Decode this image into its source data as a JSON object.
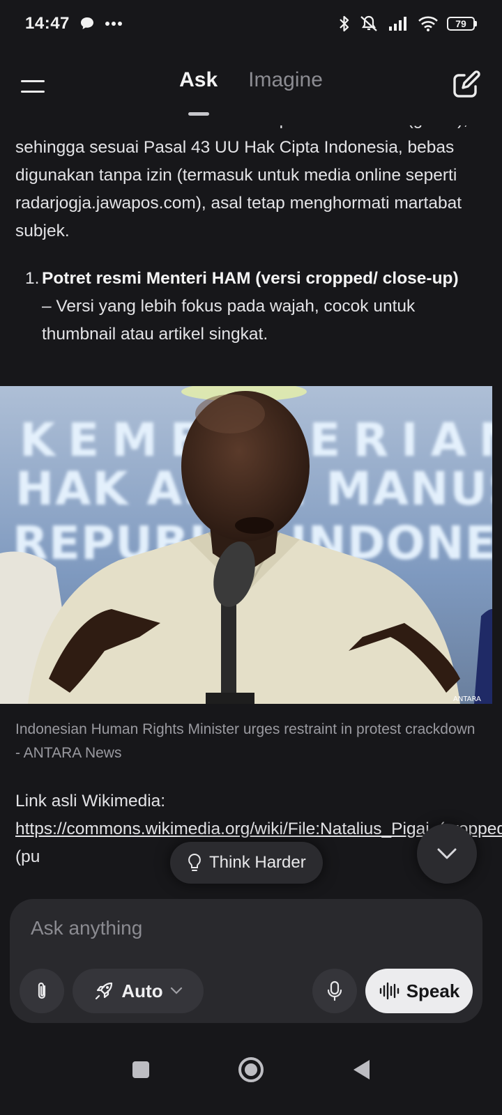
{
  "status_bar": {
    "time": "14:47",
    "left_icons": [
      "chat-bubble-icon",
      "more-dots-icon"
    ],
    "right_icons": [
      "bluetooth-icon",
      "mute-icon",
      "signal-icon",
      "wifi-icon"
    ],
    "battery": "79"
  },
  "header": {
    "tabs": [
      {
        "label": "Ask",
        "active": true
      },
      {
        "label": "Imagine",
        "active": false
      }
    ]
  },
  "content": {
    "cut_line": "Data dari situs web Pemerintah Republik Indonesia (gov.id),",
    "paragraph1": "sehingga sesuai Pasal 43 UU Hak Cipta Indonesia, bebas digunakan tanpa izin (termasuk untuk media online seperti radarjogja.jawapos.com), asal tetap menghormati martabat subjek.",
    "list_item": {
      "number": "1.",
      "bold": "Potret resmi Menteri HAM (versi cropped/ close-up)",
      "text": " – Versi yang lebih fokus pada wajah, cocok untuk thumbnail atau artikel singkat."
    },
    "image": {
      "banner_lines": [
        "KEMENTERIAN",
        "HAK ASASI MANUSIA",
        "REPUBLIK INDONESIA"
      ],
      "watermark": "ANTARA"
    },
    "caption": "Indonesian Human Rights Minister urges restraint in protest crackdown -  ANTARA News",
    "link_label": "Link asli Wikimedia:",
    "link_url": "https://commons.wikimedia.org/wiki/File:Natalius_Pigai_(cropped).png",
    "link_suffix": " (pu"
  },
  "think_button": {
    "label": "Think Harder"
  },
  "composer": {
    "placeholder": "Ask anything",
    "mode_label": "Auto",
    "speak_label": "Speak"
  },
  "colors": {
    "background": "#17171a",
    "composer": "#29292d",
    "speak_button": "#ececee"
  }
}
